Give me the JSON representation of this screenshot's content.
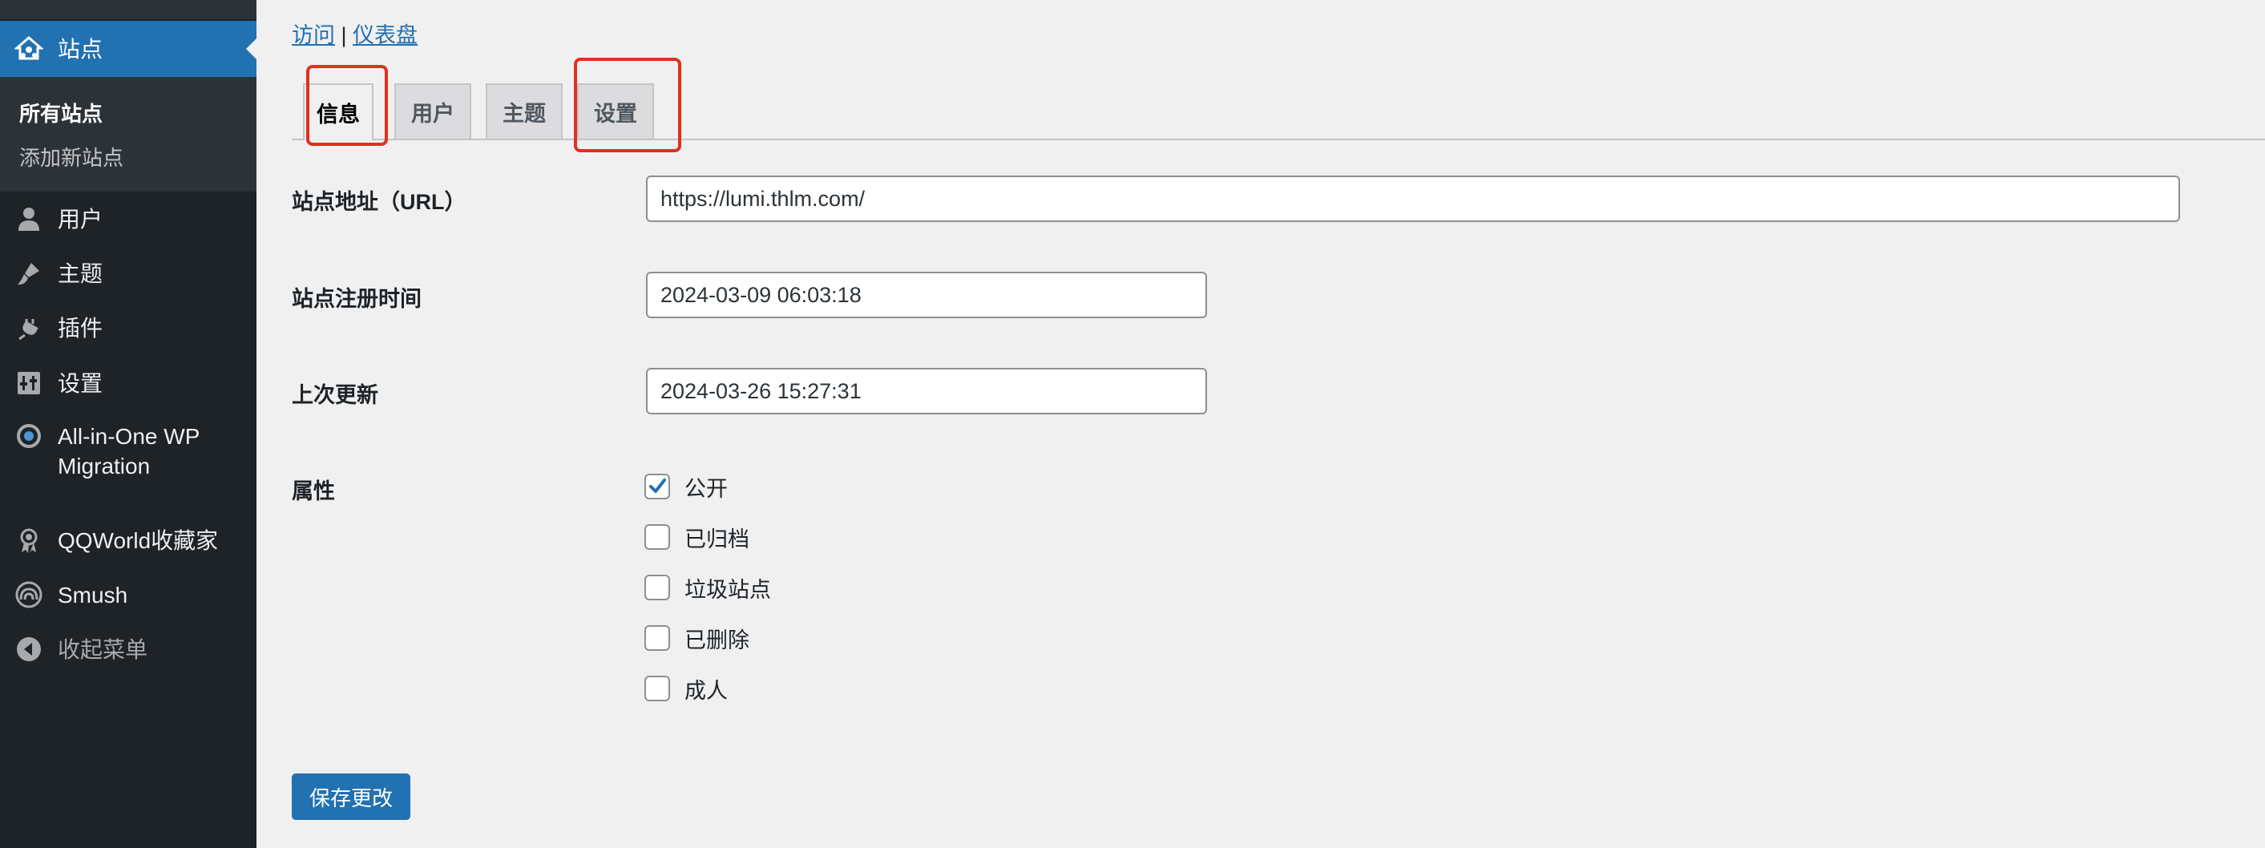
{
  "sidebar": {
    "active_item": {
      "label": "站点",
      "icon": "network-icon"
    },
    "submenu": [
      {
        "label": "所有站点",
        "current": true
      },
      {
        "label": "添加新站点",
        "current": false
      }
    ],
    "items": [
      {
        "label": "用户",
        "icon": "user-icon"
      },
      {
        "label": "主题",
        "icon": "paintbrush-icon"
      },
      {
        "label": "插件",
        "icon": "plugin-icon"
      },
      {
        "label": "设置",
        "icon": "settings-icon"
      },
      {
        "label_line1": "All-in-One WP",
        "label_line2": "Migration",
        "icon": "migration-icon"
      },
      {
        "label": "QQWorld收藏家",
        "icon": "award-icon"
      },
      {
        "label": "Smush",
        "icon": "smush-icon"
      },
      {
        "label": "收起菜单",
        "icon": "collapse-icon"
      }
    ]
  },
  "header": {
    "links": {
      "visit": "访问",
      "separator": "|",
      "dashboard": "仪表盘"
    }
  },
  "tabs": [
    {
      "label": "信息",
      "active": true
    },
    {
      "label": "用户",
      "active": false
    },
    {
      "label": "主题",
      "active": false
    },
    {
      "label": "设置",
      "active": false
    }
  ],
  "form": {
    "url": {
      "label": "站点地址（URL）",
      "value": "https://lumi.thlm.com/"
    },
    "registered": {
      "label": "站点注册时间",
      "value": "2024-03-09 06:03:18"
    },
    "updated": {
      "label": "上次更新",
      "value": "2024-03-26 15:27:31"
    },
    "attributes": {
      "label": "属性",
      "options": [
        {
          "label": "公开",
          "checked": true
        },
        {
          "label": "已归档",
          "checked": false
        },
        {
          "label": "垃圾站点",
          "checked": false
        },
        {
          "label": "已删除",
          "checked": false
        },
        {
          "label": "成人",
          "checked": false
        }
      ]
    },
    "save_label": "保存更改"
  },
  "colors": {
    "sidebar_bg": "#1d2327",
    "accent": "#2271b1",
    "highlight": "#e0301e"
  }
}
